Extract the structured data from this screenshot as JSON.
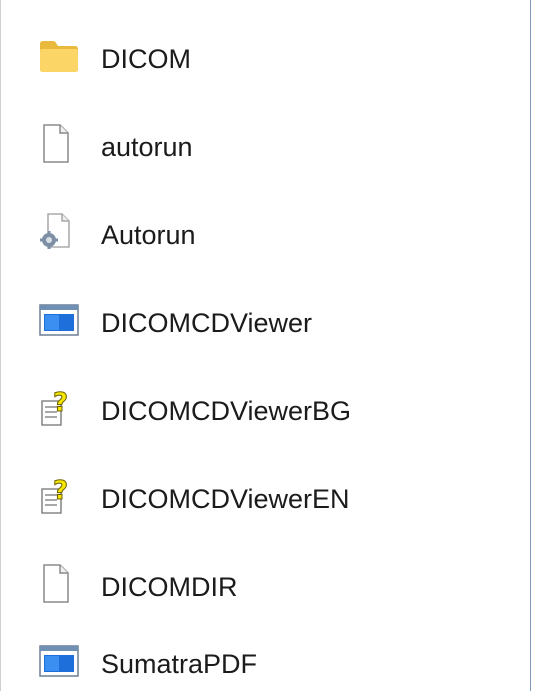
{
  "file_list": {
    "items": [
      {
        "label": "DICOM",
        "icon": "folder-icon"
      },
      {
        "label": "autorun",
        "icon": "blank-file-icon"
      },
      {
        "label": "Autorun",
        "icon": "settings-file-icon"
      },
      {
        "label": "DICOMCDViewer",
        "icon": "application-icon"
      },
      {
        "label": "DICOMCDViewerBG",
        "icon": "help-file-icon"
      },
      {
        "label": "DICOMCDViewerEN",
        "icon": "help-file-icon"
      },
      {
        "label": "DICOMDIR",
        "icon": "blank-file-icon"
      },
      {
        "label": "SumatraPDF",
        "icon": "application-icon"
      }
    ]
  }
}
